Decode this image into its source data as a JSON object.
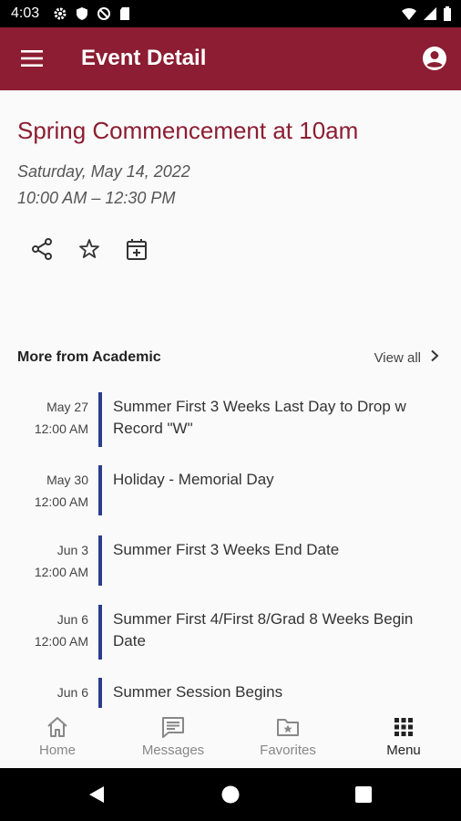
{
  "status_bar": {
    "time": "4:03",
    "icons": [
      "gear-icon",
      "shield-icon",
      "no-sim-icon",
      "sd-card-icon",
      "wifi-icon",
      "signal-icon",
      "battery-icon"
    ]
  },
  "app_bar": {
    "title": "Event Detail",
    "color": "#8c1d32"
  },
  "event": {
    "title": "Spring Commencement at 10am",
    "date": "Saturday, May 14, 2022",
    "time": "10:00 AM – 12:30 PM",
    "actions": [
      "share-icon",
      "star-icon",
      "add-to-calendar-icon"
    ]
  },
  "more_section": {
    "heading": "More from Academic",
    "view_all": "View all",
    "accent": "#2b3d8f",
    "events": [
      {
        "date": "May 27",
        "time": "12:00 AM",
        "name_lines": [
          "Summer First 3 Weeks Last Day to Drop w",
          "Record \"W\""
        ]
      },
      {
        "date": "May 30",
        "time": "12:00 AM",
        "name_lines": [
          "Holiday - Memorial Day"
        ]
      },
      {
        "date": "Jun 3",
        "time": "12:00 AM",
        "name_lines": [
          "Summer First 3 Weeks End Date"
        ]
      },
      {
        "date": "Jun 6",
        "time": "12:00 AM",
        "name_lines": [
          "Summer First 4/First 8/Grad 8 Weeks Begin",
          "Date"
        ]
      },
      {
        "date": "Jun 6",
        "time": "",
        "name_lines": [
          "Summer Session Begins"
        ]
      }
    ]
  },
  "bottom_nav": {
    "tabs": [
      {
        "label": "Home",
        "icon": "home-icon",
        "active": false
      },
      {
        "label": "Messages",
        "icon": "messages-icon",
        "active": false
      },
      {
        "label": "Favorites",
        "icon": "favorites-folder-icon",
        "active": false
      },
      {
        "label": "Menu",
        "icon": "grid-menu-icon",
        "active": true
      }
    ]
  }
}
